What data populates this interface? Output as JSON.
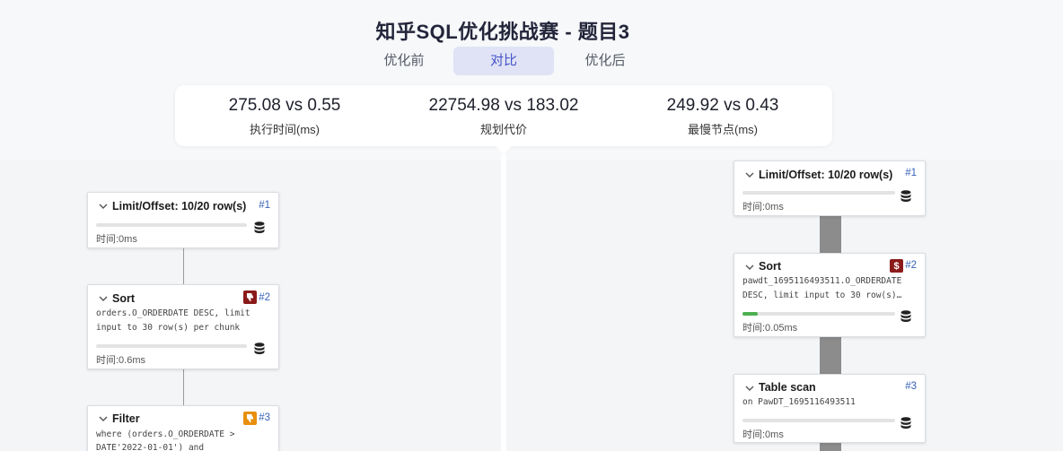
{
  "title": "知乎SQL优化挑战赛 - 题目3",
  "tabs": [
    {
      "label": "优化前",
      "active": false
    },
    {
      "label": "对比",
      "active": true
    },
    {
      "label": "优化后",
      "active": false
    }
  ],
  "metrics": [
    {
      "value": "275.08 vs 0.55",
      "label": "执行时间(ms)"
    },
    {
      "value": "22754.98 vs 183.02",
      "label": "规划代价"
    },
    {
      "value": "249.92 vs 0.43",
      "label": "最慢节点(ms)"
    }
  ],
  "colors": {
    "accent": "#4753c9",
    "badge_red": "#8b1a1a",
    "badge_orange": "#e8900c",
    "progress_green": "#4caf50"
  },
  "left_plan": [
    {
      "name": "Limit/Offset: 10/20 row(s)",
      "num": "#1",
      "detail": [],
      "time": "时间:0ms",
      "progress": 0,
      "badge": null
    },
    {
      "name": "Sort",
      "num": "#2",
      "detail": [
        "orders.O_ORDERDATE DESC, limit",
        "input to 30 row(s) per chunk"
      ],
      "time": "时间:0.6ms",
      "progress": 0,
      "badge": "thumbs-down-icon-red"
    },
    {
      "name": "Filter",
      "num": "#3",
      "detail": [
        "where (orders.O_ORDERDATE >",
        "DATE'2022-01-01') and"
      ],
      "time": "",
      "progress": 0,
      "badge": "thumbs-down-icon-orange"
    }
  ],
  "right_plan": [
    {
      "name": "Limit/Offset: 10/20 row(s)",
      "num": "#1",
      "detail": [],
      "time": "时间:0ms",
      "progress": 0,
      "badge": null
    },
    {
      "name": "Sort",
      "num": "#2",
      "detail": [
        "pawdt_1695116493511.O_ORDERDATE",
        "DESC, limit input to 30 row(s)…"
      ],
      "time": "时间:0.05ms",
      "progress": 0.1,
      "badge": "dollar-icon-red"
    },
    {
      "name": "Table scan",
      "num": "#3",
      "detail": [
        "on PawDT_1695116493511"
      ],
      "time": "时间:0ms",
      "progress": 0,
      "badge": null
    }
  ]
}
